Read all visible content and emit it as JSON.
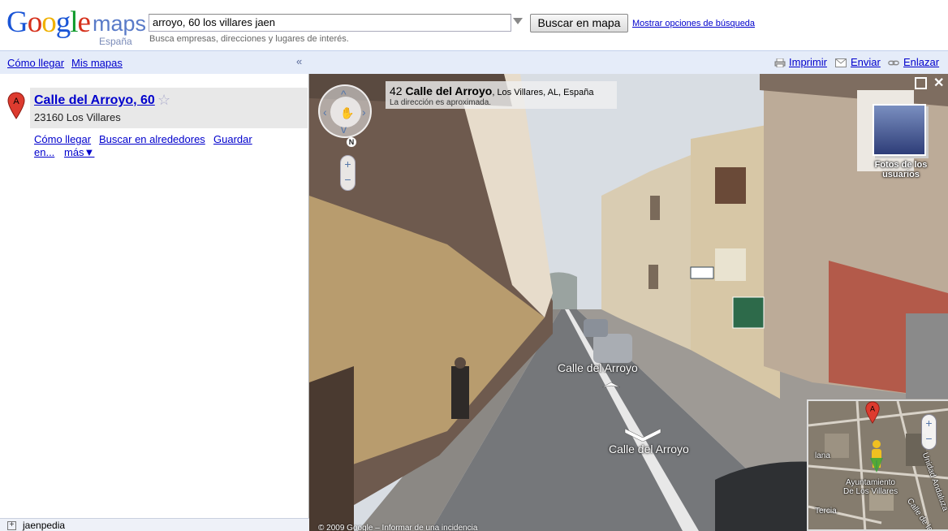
{
  "logo": {
    "google": "Google",
    "maps": "maps",
    "country": "España"
  },
  "search": {
    "value": "arroyo, 60 los villares jaen",
    "button": "Buscar en mapa",
    "options_link": "Mostrar opciones de búsqueda",
    "hint": "Busca empresas, direcciones y lugares de interés."
  },
  "leftbar": {
    "directions": "Cómo llegar",
    "my_maps": "Mis mapas",
    "collapse": "«"
  },
  "rightbar": {
    "print": "Imprimir",
    "send": "Enviar",
    "link": "Enlazar"
  },
  "result": {
    "marker": "A",
    "title": "Calle del Arroyo, 60",
    "address": "23160 Los Villares",
    "actions": [
      "Cómo llegar",
      "Buscar en alrededores",
      "Guardar en...",
      "más▼"
    ]
  },
  "layers": {
    "jaenpedia": "jaenpedia"
  },
  "streetview": {
    "addr_number": "42",
    "addr_street": "Calle del Arroyo",
    "addr_rest": ", Los Villares, AL, España",
    "addr_note": "La dirección es aproximada.",
    "compass": "N",
    "zoom_in": "+",
    "zoom_out": "−",
    "photos_label": "Fotos de los usuarios",
    "street_label_far": "Calle del Arroyo",
    "street_label_near": "Calle del Arroyo",
    "close": "✕",
    "footer": "© 2009 Google – Informar de una incidencia"
  },
  "minimap": {
    "marker": "A",
    "labels": [
      "Ayuntamiento",
      "De Los Villares",
      "Tercia",
      "lana",
      "Unidad Andaluza",
      "Calle de la"
    ]
  },
  "colors": {
    "link": "#0000cc",
    "bar_bg": "#e5ecf9",
    "result_bg": "#e8e8e8",
    "marker_red": "#dd3b2f"
  }
}
